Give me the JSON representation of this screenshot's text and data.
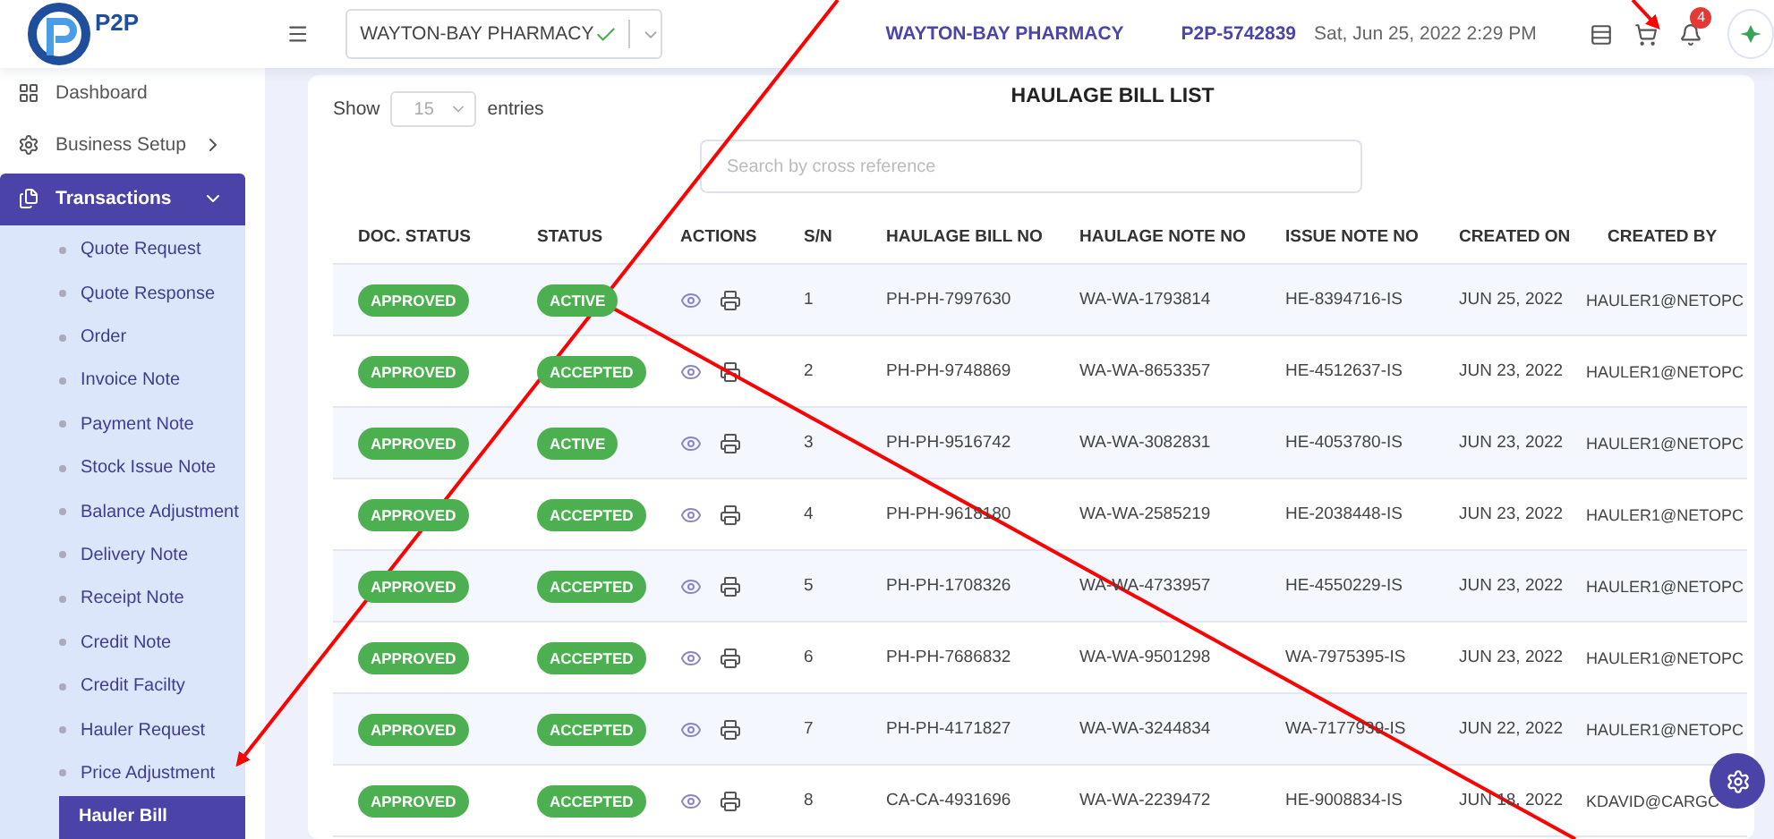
{
  "header": {
    "logo_text": "P2P",
    "pharmacy_select": {
      "value": "WAYTON-BAY PHARMACY"
    },
    "company": "WAYTON-BAY PHARMACY",
    "account": "P2P-5742839",
    "datetime": "Sat, Jun 25, 2022 2:29 PM",
    "notification_count": "4"
  },
  "sidebar": {
    "items": [
      {
        "label": "Dashboard",
        "kind": "dashboard",
        "selected": false
      },
      {
        "label": "Business Setup",
        "kind": "setup",
        "selected": false
      },
      {
        "label": "Transactions",
        "kind": "transactions",
        "selected": true,
        "expanded": true,
        "children": [
          {
            "label": "Quote Request",
            "selected": false
          },
          {
            "label": "Quote Response",
            "selected": false
          },
          {
            "label": "Order",
            "selected": false
          },
          {
            "label": "Invoice Note",
            "selected": false
          },
          {
            "label": "Payment Note",
            "selected": false
          },
          {
            "label": "Stock Issue Note",
            "selected": false
          },
          {
            "label": "Balance Adjustment",
            "selected": false
          },
          {
            "label": "Delivery Note",
            "selected": false
          },
          {
            "label": "Receipt Note",
            "selected": false
          },
          {
            "label": "Credit Note",
            "selected": false
          },
          {
            "label": "Credit Facilty",
            "selected": false
          },
          {
            "label": "Hauler Request",
            "selected": false
          },
          {
            "label": "Price Adjustment",
            "selected": false
          },
          {
            "label": "Hauler Bill",
            "selected": true
          }
        ]
      }
    ]
  },
  "list": {
    "title": "HAULAGE BILL LIST",
    "show_label": "Show",
    "entries_value": "15",
    "entries_label": "entries",
    "search": {
      "placeholder": "Search by cross reference"
    },
    "columns": [
      "DOC. STATUS",
      "STATUS",
      "ACTIONS",
      "S/N",
      "HAULAGE BILL NO",
      "HAULAGE NOTE NO",
      "ISSUE NOTE NO",
      "CREATED ON",
      "CREATED BY"
    ],
    "rows": [
      {
        "doc_status": "APPROVED",
        "status": "ACTIVE",
        "sn": "1",
        "bill_no": "PH-PH-7997630",
        "note_no": "WA-WA-1793814",
        "issue_no": "HE-8394716-IS",
        "created_on": "JUN 25, 2022",
        "created_by": "HAULER1@NETOPC"
      },
      {
        "doc_status": "APPROVED",
        "status": "ACCEPTED",
        "sn": "2",
        "bill_no": "PH-PH-9748869",
        "note_no": "WA-WA-8653357",
        "issue_no": "HE-4512637-IS",
        "created_on": "JUN 23, 2022",
        "created_by": "HAULER1@NETOPC"
      },
      {
        "doc_status": "APPROVED",
        "status": "ACTIVE",
        "sn": "3",
        "bill_no": "PH-PH-9516742",
        "note_no": "WA-WA-3082831",
        "issue_no": "HE-4053780-IS",
        "created_on": "JUN 23, 2022",
        "created_by": "HAULER1@NETOPC"
      },
      {
        "doc_status": "APPROVED",
        "status": "ACCEPTED",
        "sn": "4",
        "bill_no": "PH-PH-9618180",
        "note_no": "WA-WA-2585219",
        "issue_no": "HE-2038448-IS",
        "created_on": "JUN 23, 2022",
        "created_by": "HAULER1@NETOPC"
      },
      {
        "doc_status": "APPROVED",
        "status": "ACCEPTED",
        "sn": "5",
        "bill_no": "PH-PH-1708326",
        "note_no": "WA-WA-4733957",
        "issue_no": "HE-4550229-IS",
        "created_on": "JUN 23, 2022",
        "created_by": "HAULER1@NETOPC"
      },
      {
        "doc_status": "APPROVED",
        "status": "ACCEPTED",
        "sn": "6",
        "bill_no": "PH-PH-7686832",
        "note_no": "WA-WA-9501298",
        "issue_no": "WA-7975395-IS",
        "created_on": "JUN 23, 2022",
        "created_by": "HAULER1@NETOPC"
      },
      {
        "doc_status": "APPROVED",
        "status": "ACCEPTED",
        "sn": "7",
        "bill_no": "PH-PH-4171827",
        "note_no": "WA-WA-3244834",
        "issue_no": "WA-7177939-IS",
        "created_on": "JUN 22, 2022",
        "created_by": "HAULER1@NETOPC"
      },
      {
        "doc_status": "APPROVED",
        "status": "ACCEPTED",
        "sn": "8",
        "bill_no": "CA-CA-4931696",
        "note_no": "WA-WA-2239472",
        "issue_no": "HE-9008834-IS",
        "created_on": "JUN 18, 2022",
        "created_by": "KDAVID@CARGC"
      }
    ]
  }
}
